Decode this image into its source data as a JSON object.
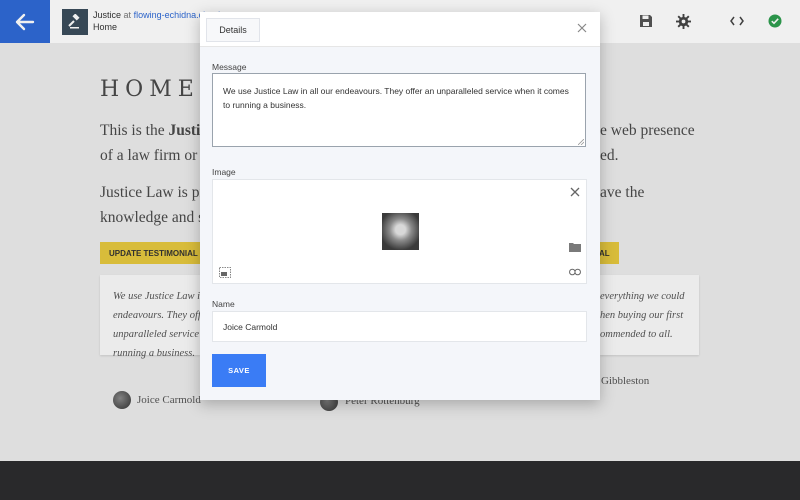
{
  "topbar": {
    "site_name": "Justice",
    "site_at": "at",
    "site_domain": "flowing-echidna.cloud",
    "page_name": "Home"
  },
  "page": {
    "heading": "HOME",
    "para1_line1": "This is the",
    "para1_bold": "Justic",
    "para1_line1_right": "e web presence",
    "para1_line2": "of a law firm or b",
    "para1_line2_right": "ed.",
    "para2_line1": "Justice Law is pre",
    "para2_line1_right": "ave the",
    "para2_line2": "knowledge and s",
    "update_testimonial_label": "UPDATE TESTIMONIAL",
    "update_testimonial_right_label": "AL",
    "testimonial_left": [
      "We use Justice Law i",
      "endeavours. They off",
      "unparalleled service",
      "running a business."
    ],
    "testimonial_right": [
      "everything we could",
      "hen buying our first",
      "ommended to all."
    ],
    "authors": [
      "Joice Carmold",
      "Peter Rottenburg",
      "Gibbleston"
    ]
  },
  "modal": {
    "tab_label": "Details",
    "message_label": "Message",
    "message_value": "We use Justice Law in all our endeavours. They offer an unparalleled service when it comes to running a business.",
    "image_label": "Image",
    "name_label": "Name",
    "name_value": "Joice Carmold",
    "save_label": "SAVE"
  },
  "colors": {
    "accent": "#2f6ad6",
    "save_button": "#3a7cf5",
    "yellow_button": "#e6c83e",
    "status_ok": "#2e9e4f",
    "footer": "#2c2c2e"
  },
  "icons": {
    "back": "arrow-left-icon",
    "save": "floppy-disk-icon",
    "settings": "gear-icon",
    "code": "code-brackets-icon",
    "status": "check-circle-icon",
    "close": "close-icon",
    "folder": "folder-icon",
    "link": "link-icon",
    "image_select": "image-select-icon"
  }
}
